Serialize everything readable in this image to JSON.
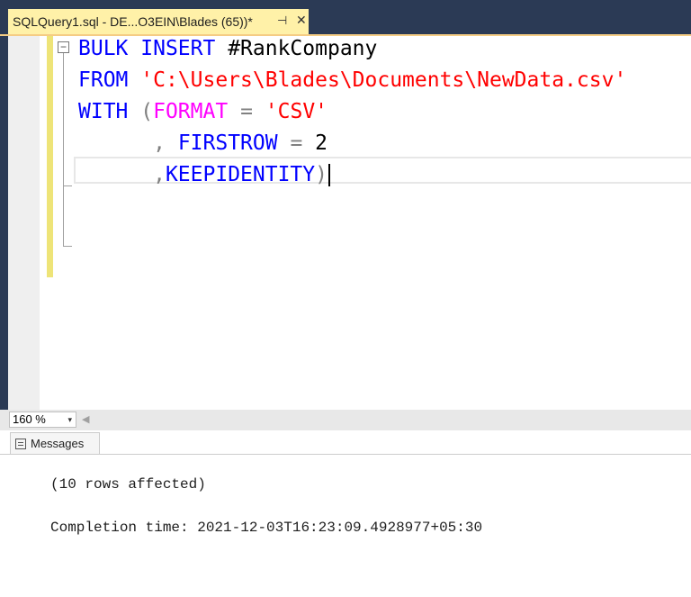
{
  "tab": {
    "title": "SQLQuery1.sql - DE...O3EIN\\Blades (65))*",
    "pin_icon": "pin-icon",
    "close_icon": "close-icon"
  },
  "editor": {
    "fold_icon": "collapse-icon",
    "lines": [
      [
        "BULK",
        " ",
        "INSERT",
        " #RankCompany"
      ],
      [
        "FROM",
        " ",
        "'C:\\Users\\Blades\\Documents\\NewData.csv'"
      ],
      [
        "WITH",
        " ",
        "(",
        "FORMAT",
        " ",
        "=",
        " ",
        "'CSV'"
      ],
      [
        "      ",
        ",",
        " ",
        "FIRSTROW",
        " ",
        "=",
        " 2"
      ],
      [
        "      ",
        ",",
        "KEEPIDENTITY",
        ")"
      ]
    ]
  },
  "status": {
    "zoom": "160 %",
    "zoom_arrow": "▾",
    "scroll_left": "◀"
  },
  "messages": {
    "tab_label": "Messages",
    "tab_icon": "messages-icon",
    "rows_affected": "(10 rows affected)",
    "completion_time": "Completion time: 2021-12-03T16:23:09.4928977+05:30"
  },
  "colors": {
    "keyword": "#0000ff",
    "string": "#ff0000",
    "function": "#ff00ff",
    "punctuation": "#808080",
    "tab_active": "#fff1a8",
    "chrome": "#2b3a55"
  }
}
